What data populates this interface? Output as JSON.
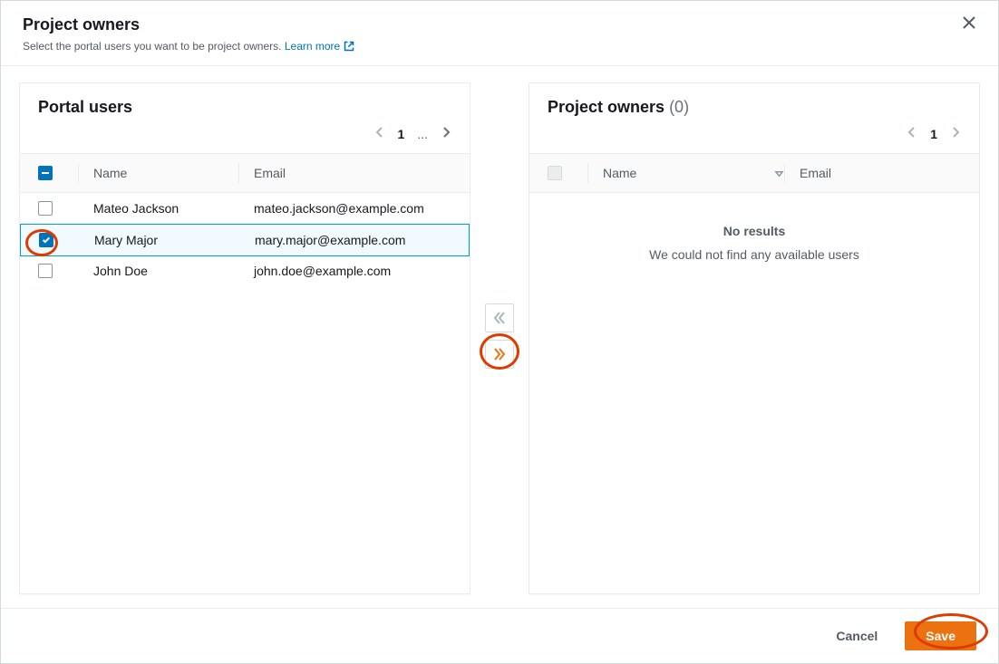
{
  "header": {
    "title": "Project owners",
    "description": "Select the portal users you want to be project owners.",
    "learnMore": "Learn more"
  },
  "leftPanel": {
    "title": "Portal users",
    "columns": {
      "name": "Name",
      "email": "Email"
    },
    "pager": {
      "page": "1",
      "ellipsis": "..."
    },
    "users": [
      {
        "name": "Mateo Jackson",
        "email": "mateo.jackson@example.com",
        "checked": false
      },
      {
        "name": "Mary Major",
        "email": "mary.major@example.com",
        "checked": true
      },
      {
        "name": "John Doe",
        "email": "john.doe@example.com",
        "checked": false
      }
    ]
  },
  "rightPanel": {
    "title": "Project owners",
    "count": "(0)",
    "columns": {
      "name": "Name",
      "email": "Email"
    },
    "pager": {
      "page": "1"
    },
    "emptyTitle": "No results",
    "emptySub": "We could not find any available users"
  },
  "footer": {
    "cancel": "Cancel",
    "save": "Save"
  }
}
